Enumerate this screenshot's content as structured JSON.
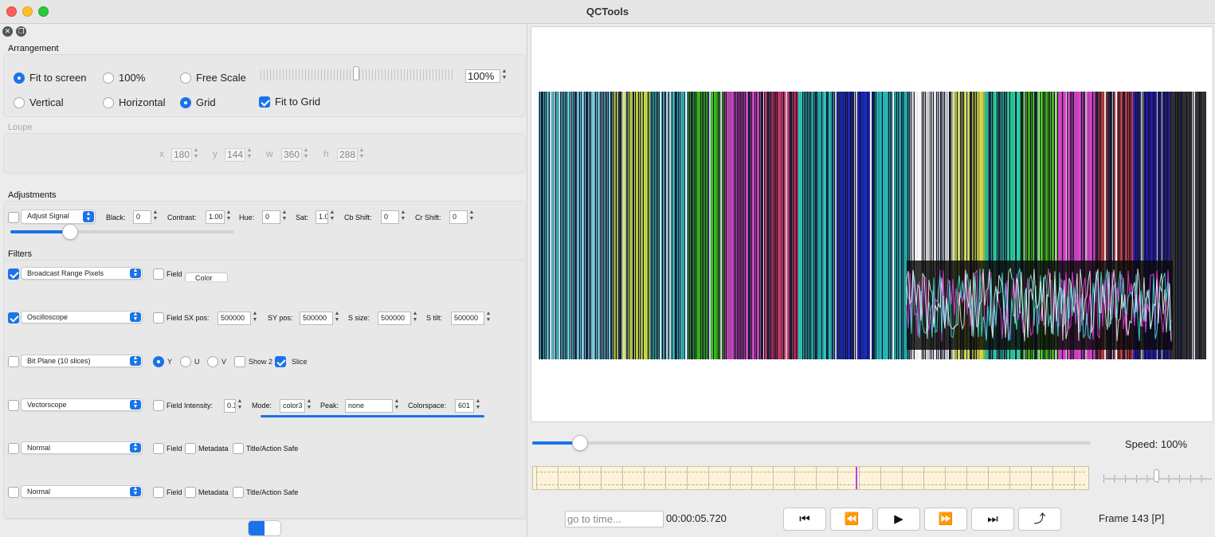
{
  "window": {
    "title": "QCTools"
  },
  "arrangement": {
    "title": "Arrangement",
    "fit_to_screen": "Fit to screen",
    "percent100": "100%",
    "free_scale": "Free Scale",
    "vertical": "Vertical",
    "horizontal": "Horizontal",
    "grid": "Grid",
    "fit_to_grid": "Fit to Grid",
    "scale_value": "100%"
  },
  "loupe": {
    "title": "Loupe",
    "x_label": "x",
    "x": "180",
    "y_label": "y",
    "y": "144",
    "w_label": "w",
    "w": "360",
    "h_label": "h",
    "h": "288"
  },
  "adjustments": {
    "title": "Adjustments",
    "mode": "Adjust Signal",
    "black_label": "Black:",
    "black": "0",
    "contrast_label": "Contrast:",
    "contrast": "1.00",
    "hue_label": "Hue:",
    "hue": "0",
    "sat_label": "Sat:",
    "sat": "1.0",
    "cb_label": "Cb Shift:",
    "cb": "0",
    "cr_label": "Cr Shift:",
    "cr": "0"
  },
  "filters": {
    "title": "Filters",
    "f1": {
      "name": "Broadcast Range Pixels",
      "field": "Field",
      "color": "Color"
    },
    "f2": {
      "name": "Oscilloscope",
      "field": "Field",
      "sx_label": "SX pos:",
      "sx": "500000",
      "sy_label": "SY pos:",
      "sy": "500000",
      "ssize_label": "S size:",
      "ssize": "500000",
      "stilt_label": "S tilt:",
      "stilt": "500000"
    },
    "f3": {
      "name": "Bit Plane (10 slices)",
      "y": "Y",
      "u": "U",
      "v": "V",
      "show2": "Show 2",
      "slice": "Slice"
    },
    "f4": {
      "name": "Vectorscope",
      "field": "Field",
      "intensity_label": "Intensity:",
      "intensity": "0.1",
      "mode_label": "Mode:",
      "mode": "color3",
      "peak_label": "Peak:",
      "peak": "none",
      "colorspace_label": "Colorspace:",
      "colorspace": "601"
    },
    "f5": {
      "name": "Normal",
      "field": "Field",
      "metadata": "Metadata",
      "safe": "Title/Action Safe"
    },
    "f6": {
      "name": "Normal",
      "field": "Field",
      "metadata": "Metadata",
      "safe": "Title/Action Safe"
    }
  },
  "playback": {
    "speed": "Speed: 100%",
    "goto_placeholder": "go to time...",
    "time": "00:00:05.720",
    "frame": "Frame 143 [P]",
    "position_fraction": 0.085,
    "timeline_marker_fraction": 0.58
  },
  "icons": {
    "first": "⏮",
    "prev": "⏪",
    "play": "▶",
    "next": "⏩",
    "last": "⏭",
    "export": "⤴"
  }
}
